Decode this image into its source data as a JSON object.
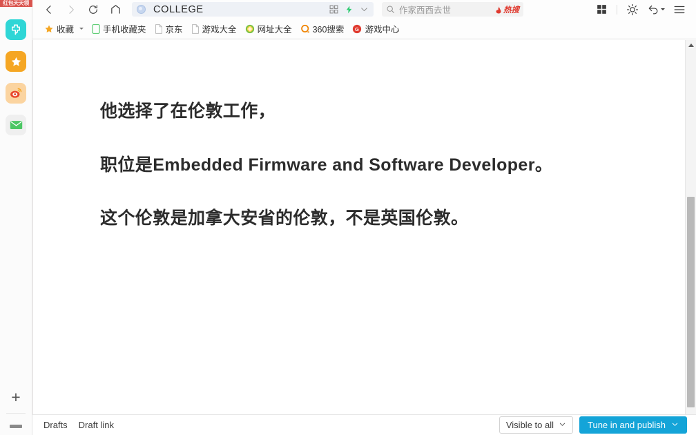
{
  "sidebar": {
    "badge_text": "红包天天领",
    "items": [
      {
        "name": "sidebar-icon-jiayou",
        "label": "加油包",
        "color": "#2fd6d6"
      },
      {
        "name": "sidebar-icon-favorites",
        "label": "收藏",
        "color": "#f5a623"
      },
      {
        "name": "sidebar-icon-weibo",
        "label": "微博",
        "color": "#fbd4a0"
      },
      {
        "name": "sidebar-icon-mail",
        "label": "邮箱",
        "color": "#efefef"
      }
    ],
    "add_label": "+"
  },
  "chrome": {
    "back_label": "后退",
    "forward_label": "前进",
    "reload_label": "刷新",
    "home_label": "主页",
    "tab": {
      "title": "COLLEGE",
      "favicon": "globe-icon"
    },
    "address_actions": [
      "qr-code-icon",
      "lightning-icon",
      "chevron-down-icon"
    ],
    "search": {
      "placeholder": "作家西西去世",
      "hot_label": "热搜"
    },
    "right_buttons": [
      "grid-icon",
      "brightness-icon",
      "undo-icon",
      "menu-icon"
    ]
  },
  "bookmarks": {
    "items": [
      {
        "label": "收藏",
        "icon": "star-icon",
        "has_caret": true
      },
      {
        "label": "手机收藏夹",
        "icon": "phone-icon"
      },
      {
        "label": "京东",
        "icon": "page-icon"
      },
      {
        "label": "游戏大全",
        "icon": "page-icon"
      },
      {
        "label": "网址大全",
        "icon": "green-plus-icon"
      },
      {
        "label": "360搜索",
        "icon": "orange-o-icon"
      },
      {
        "label": "游戏中心",
        "icon": "red-g-icon"
      }
    ]
  },
  "article": {
    "paragraphs": [
      "他选择了在伦敦工作，",
      "职位是Embedded Firmware and Software Developer。",
      "这个伦敦是加拿大安省的伦敦，不是英国伦敦。"
    ]
  },
  "bottombar": {
    "drafts_label": "Drafts",
    "draft_link_label": "Draft link",
    "visibility_label": "Visible to all",
    "publish_label": "Tune in and publish"
  },
  "colors": {
    "publish_button": "#14a4d8",
    "hot_search": "#e03a2f",
    "tab_background": "#eef1f6"
  }
}
